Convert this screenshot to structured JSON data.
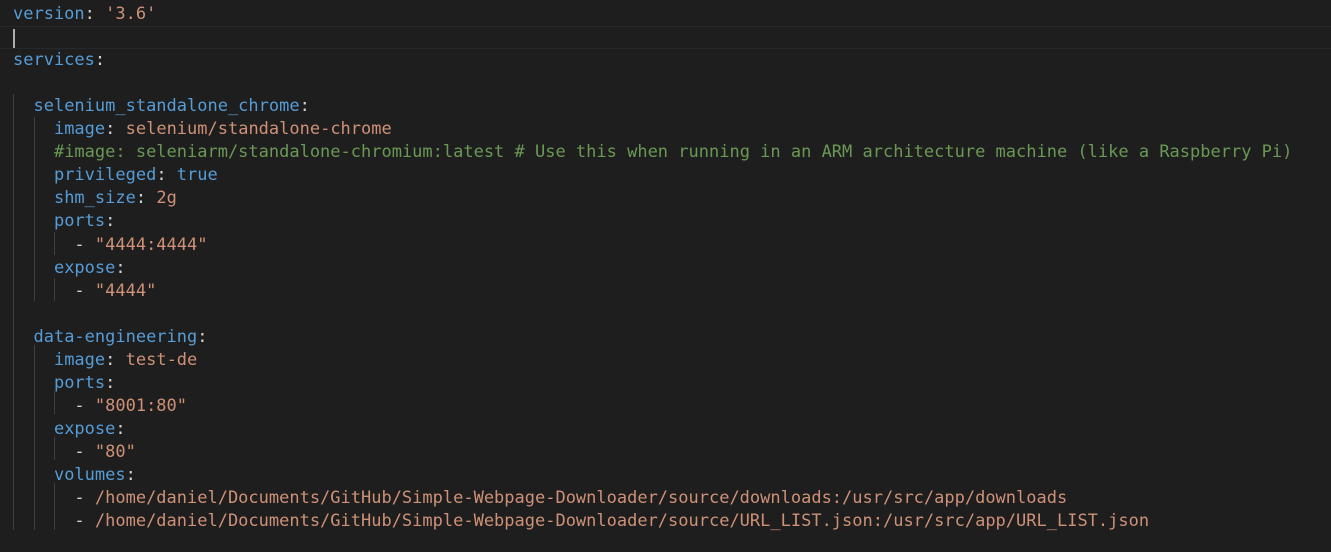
{
  "editor": {
    "language": "yaml",
    "lines": [
      {
        "tokens": [
          {
            "t": "version",
            "c": "key"
          },
          {
            "t": ": ",
            "c": "punct"
          },
          {
            "t": "'3.6'",
            "c": "str"
          }
        ]
      },
      {
        "tokens": [],
        "current": true
      },
      {
        "tokens": [
          {
            "t": "services",
            "c": "key"
          },
          {
            "t": ":",
            "c": "punct"
          }
        ]
      },
      {
        "tokens": []
      },
      {
        "tokens": [
          {
            "t": "  ",
            "c": "punct"
          },
          {
            "t": "selenium_standalone_chrome",
            "c": "key"
          },
          {
            "t": ":",
            "c": "punct"
          }
        ]
      },
      {
        "tokens": [
          {
            "t": "    ",
            "c": "punct"
          },
          {
            "t": "image",
            "c": "key"
          },
          {
            "t": ": ",
            "c": "punct"
          },
          {
            "t": "selenium/standalone-chrome",
            "c": "str"
          }
        ]
      },
      {
        "tokens": [
          {
            "t": "    ",
            "c": "punct"
          },
          {
            "t": "#image: seleniarm/standalone-chromium:latest # Use this when running in an ARM architecture machine (like a Raspberry Pi)",
            "c": "comment"
          }
        ]
      },
      {
        "tokens": [
          {
            "t": "    ",
            "c": "punct"
          },
          {
            "t": "privileged",
            "c": "key"
          },
          {
            "t": ": ",
            "c": "punct"
          },
          {
            "t": "true",
            "c": "bool"
          }
        ]
      },
      {
        "tokens": [
          {
            "t": "    ",
            "c": "punct"
          },
          {
            "t": "shm_size",
            "c": "key"
          },
          {
            "t": ": ",
            "c": "punct"
          },
          {
            "t": "2g",
            "c": "str"
          }
        ]
      },
      {
        "tokens": [
          {
            "t": "    ",
            "c": "punct"
          },
          {
            "t": "ports",
            "c": "key"
          },
          {
            "t": ":",
            "c": "punct"
          }
        ]
      },
      {
        "tokens": [
          {
            "t": "      - ",
            "c": "punct"
          },
          {
            "t": "\"4444:4444\"",
            "c": "str"
          }
        ]
      },
      {
        "tokens": [
          {
            "t": "    ",
            "c": "punct"
          },
          {
            "t": "expose",
            "c": "key"
          },
          {
            "t": ":",
            "c": "punct"
          }
        ]
      },
      {
        "tokens": [
          {
            "t": "      - ",
            "c": "punct"
          },
          {
            "t": "\"4444\"",
            "c": "str"
          }
        ]
      },
      {
        "tokens": []
      },
      {
        "tokens": [
          {
            "t": "  ",
            "c": "punct"
          },
          {
            "t": "data-engineering",
            "c": "key"
          },
          {
            "t": ":",
            "c": "punct"
          }
        ]
      },
      {
        "tokens": [
          {
            "t": "    ",
            "c": "punct"
          },
          {
            "t": "image",
            "c": "key"
          },
          {
            "t": ": ",
            "c": "punct"
          },
          {
            "t": "test-de",
            "c": "str"
          }
        ]
      },
      {
        "tokens": [
          {
            "t": "    ",
            "c": "punct"
          },
          {
            "t": "ports",
            "c": "key"
          },
          {
            "t": ":",
            "c": "punct"
          }
        ]
      },
      {
        "tokens": [
          {
            "t": "      - ",
            "c": "punct"
          },
          {
            "t": "\"8001:80\"",
            "c": "str"
          }
        ]
      },
      {
        "tokens": [
          {
            "t": "    ",
            "c": "punct"
          },
          {
            "t": "expose",
            "c": "key"
          },
          {
            "t": ":",
            "c": "punct"
          }
        ]
      },
      {
        "tokens": [
          {
            "t": "      - ",
            "c": "punct"
          },
          {
            "t": "\"80\"",
            "c": "str"
          }
        ]
      },
      {
        "tokens": [
          {
            "t": "    ",
            "c": "punct"
          },
          {
            "t": "volumes",
            "c": "key"
          },
          {
            "t": ":",
            "c": "punct"
          }
        ]
      },
      {
        "tokens": [
          {
            "t": "      - ",
            "c": "punct"
          },
          {
            "t": "/home/daniel/Documents/GitHub/Simple-Webpage-Downloader/source/downloads:/usr/src/app/downloads",
            "c": "str"
          }
        ]
      },
      {
        "tokens": [
          {
            "t": "      - ",
            "c": "punct"
          },
          {
            "t": "/home/daniel/Documents/GitHub/Simple-Webpage-Downloader/source/URL_LIST.json:/usr/src/app/URL_LIST.json",
            "c": "str"
          }
        ]
      }
    ]
  }
}
